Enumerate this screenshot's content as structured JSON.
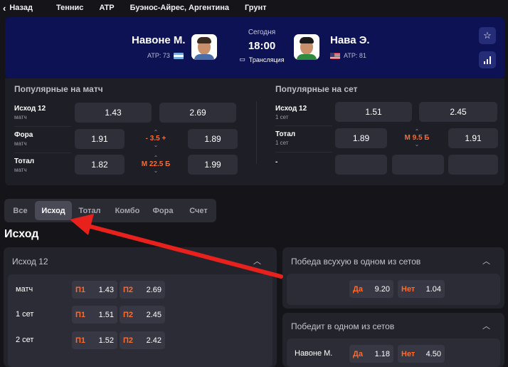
{
  "nav": {
    "back_label": "Назад",
    "breadcrumbs": [
      "Теннис",
      "ATP",
      "Буэнос-Айрес, Аргентина",
      "Грунт"
    ]
  },
  "match": {
    "player1": {
      "name": "Навоне М.",
      "rank": "ATP: 73",
      "flag": "argentina"
    },
    "player2": {
      "name": "Нава Э.",
      "rank": "ATP: 81",
      "flag": "usa"
    },
    "day": "Сегодня",
    "time": "18:00",
    "stream_label": "Трансляция"
  },
  "popular_match": {
    "title": "Популярные на матч",
    "rows": [
      {
        "label": "Исход 12",
        "sub": "матч",
        "odd1": "1.43",
        "odd2": "2.69"
      },
      {
        "label": "Фора",
        "sub": "матч",
        "odd1": "1.91",
        "line": "- 3.5 +",
        "odd2": "1.89"
      },
      {
        "label": "Тотал",
        "sub": "матч",
        "odd1": "1.82",
        "line": "М 22.5 Б",
        "odd2": "1.99"
      }
    ]
  },
  "popular_set": {
    "title": "Популярные на сет",
    "rows": [
      {
        "label": "Исход 12",
        "sub": "1 сет",
        "odd1": "1.51",
        "odd2": "2.45"
      },
      {
        "label": "Тотал",
        "sub": "1 сет",
        "odd1": "1.89",
        "line": "М 9.5 Б",
        "odd2": "1.91"
      },
      {
        "label": "-",
        "sub": ""
      }
    ]
  },
  "tabs": [
    "Все",
    "Исход",
    "Тотал",
    "Комбо",
    "Фора",
    "Счет"
  ],
  "active_tab": "Исход",
  "section_heading": "Исход",
  "markets": {
    "outcome12": {
      "title": "Исход 12",
      "rows": [
        {
          "label": "матч",
          "l1": "П1",
          "o1": "1.43",
          "l2": "П2",
          "o2": "2.69"
        },
        {
          "label": "1 сет",
          "l1": "П1",
          "o1": "1.51",
          "l2": "П2",
          "o2": "2.45"
        },
        {
          "label": "2 сет",
          "l1": "П1",
          "o1": "1.52",
          "l2": "П2",
          "o2": "2.42"
        }
      ]
    },
    "straight_win": {
      "title": "Победа всухую в одном из сетов",
      "l1": "Да",
      "o1": "9.20",
      "l2": "Нет",
      "o2": "1.04"
    },
    "win_a_set": {
      "title": "Победит в одном из сетов",
      "row_label": "Навоне М.",
      "l1": "Да",
      "o1": "1.18",
      "l2": "Нет",
      "o2": "4.50"
    }
  },
  "colors": {
    "accent": "#ff6a2b",
    "banner": "#0c1254",
    "annotation_arrow": "#e8211d"
  }
}
